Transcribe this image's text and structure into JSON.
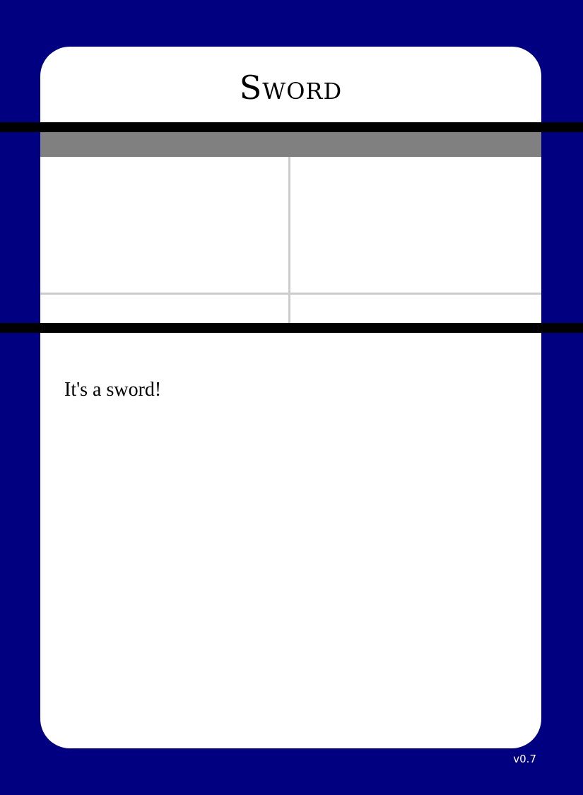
{
  "card": {
    "title": "Sword",
    "description": "It's a sword!",
    "version": "v0.7"
  },
  "colors": {
    "background": "#000080",
    "card_face": "#ffffff",
    "band": "#000000",
    "stat_header": "#808080",
    "grid_lines": "#cccccc"
  }
}
